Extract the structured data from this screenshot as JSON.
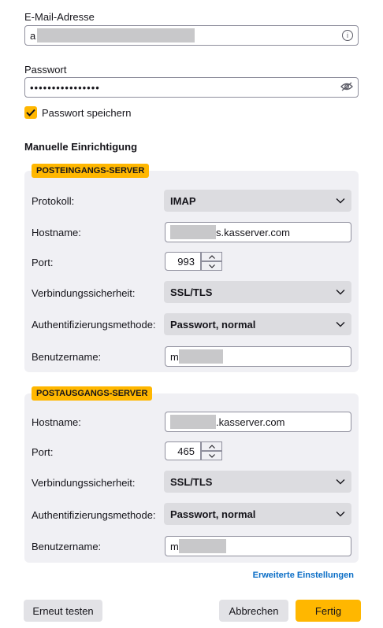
{
  "email": {
    "label": "E-Mail-Adresse",
    "value_prefix": "a"
  },
  "password": {
    "label": "Passwort",
    "value": "••••••••••••••••"
  },
  "remember": {
    "label": "Passwort speichern",
    "checked": true
  },
  "manual": {
    "title": "Manuelle Einrichtigung",
    "incoming": {
      "badge": "POSTEINGANGS-SERVER",
      "protocol_label": "Protokoll:",
      "protocol_value": "IMAP",
      "hostname_label": "Hostname:",
      "hostname_suffix": "s.kasserver.com",
      "port_label": "Port:",
      "port_value": "993",
      "security_label": "Verbindungssicherheit:",
      "security_value": "SSL/TLS",
      "auth_label": "Authentifizierungsmethode:",
      "auth_value": "Passwort, normal",
      "username_label": "Benutzername:",
      "username_prefix": "m"
    },
    "outgoing": {
      "badge": "POSTAUSGANGS-SERVER",
      "hostname_label": "Hostname:",
      "hostname_suffix": ".kasserver.com",
      "port_label": "Port:",
      "port_value": "465",
      "security_label": "Verbindungssicherheit:",
      "security_value": "SSL/TLS",
      "auth_label": "Authentifizierungsmethode:",
      "auth_value": "Passwort, normal",
      "username_label": "Benutzername:",
      "username_prefix": "m"
    }
  },
  "advanced_link": "Erweiterte Einstellungen",
  "buttons": {
    "retest": "Erneut testen",
    "cancel": "Abbrechen",
    "done": "Fertig"
  },
  "colors": {
    "accent": "#ffb700",
    "link": "#0a6dc6",
    "section_bg": "#f0f0f4"
  }
}
